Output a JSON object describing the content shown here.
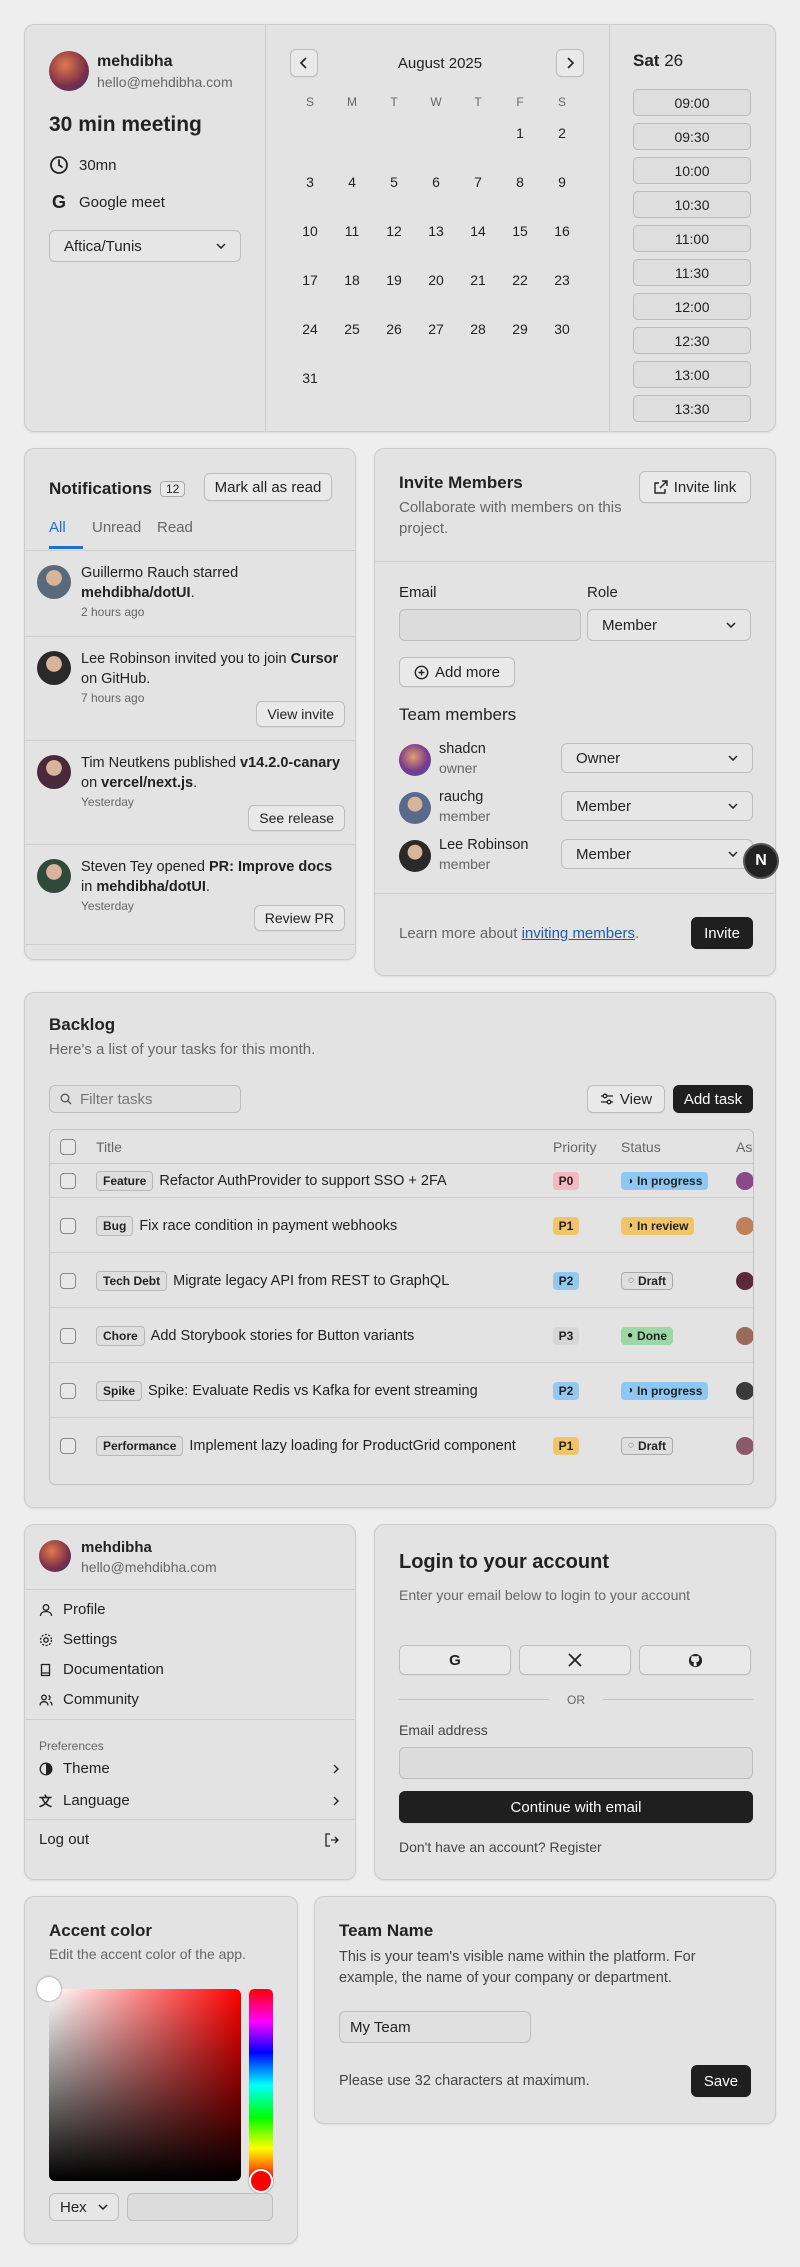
{
  "scheduler": {
    "user": {
      "name": "mehdibha",
      "email": "hello@mehdibha.com"
    },
    "meeting_title": "30 min meeting",
    "duration": "30mn",
    "location": "Google meet",
    "timezone": "Aftica/Tunis",
    "month_label": "August 2025",
    "weekdays": [
      "S",
      "M",
      "T",
      "W",
      "T",
      "F",
      "S"
    ],
    "weeks": [
      [
        "",
        "",
        "",
        "",
        "",
        "1",
        "2"
      ],
      [
        "3",
        "4",
        "5",
        "6",
        "7",
        "8",
        "9"
      ],
      [
        "10",
        "11",
        "12",
        "13",
        "14",
        "15",
        "16"
      ],
      [
        "17",
        "18",
        "19",
        "20",
        "21",
        "22",
        "23"
      ],
      [
        "24",
        "25",
        "26",
        "27",
        "28",
        "29",
        "30"
      ],
      [
        "31",
        "",
        "",
        "",
        "",
        "",
        ""
      ]
    ],
    "selected_day_name": "Sat",
    "selected_day_num": "26",
    "slots": [
      "09:00",
      "09:30",
      "10:00",
      "10:30",
      "11:00",
      "11:30",
      "12:00",
      "12:30",
      "13:00",
      "13:30"
    ]
  },
  "notifications": {
    "title": "Notifications",
    "count": "12",
    "mark_all": "Mark all as read",
    "tabs": [
      "All",
      "Unread",
      "Read"
    ],
    "items": [
      {
        "name": "Guillermo Rauch",
        "action": " starred ",
        "target": "mehdibha/dotUI",
        "after": ".",
        "time": "2 hours ago",
        "button": "",
        "avatar_color": "#5a6a7a"
      },
      {
        "name": "Lee Robinson",
        "action": " invited you to join ",
        "target": "Cursor",
        "after": " on GitHub.",
        "time": "7 hours ago",
        "button": "View invite",
        "avatar_color": "#2a2a2a"
      },
      {
        "name": "Tim Neutkens",
        "action": " published ",
        "target": "v14.2.0-canary",
        "after": " on ",
        "target2": "vercel/next.js",
        "after2": ".",
        "time": "Yesterday",
        "button": "See release",
        "avatar_color": "#4a2a3a"
      },
      {
        "name": "Steven Tey",
        "action": " opened ",
        "target": "PR: Improve docs",
        "after": " in ",
        "target2": "mehdibha/dotUI",
        "after2": ".",
        "time": "Yesterday",
        "button": "Review PR",
        "avatar_color": "#2f4a3a"
      }
    ]
  },
  "invite": {
    "title": "Invite Members",
    "subtitle": "Collaborate with members on this project.",
    "invite_link": "Invite link",
    "email_label": "Email",
    "role_label": "Role",
    "role_value": "Member",
    "add_more": "Add more",
    "team_title": "Team members",
    "members": [
      {
        "name": "shadcn",
        "role": "owner",
        "select": "Owner"
      },
      {
        "name": "rauchg",
        "role": "member",
        "select": "Member"
      },
      {
        "name": "Lee Robinson",
        "role": "member",
        "select": "Member"
      }
    ],
    "learn_prefix": "Learn more about ",
    "learn_link": "inviting members",
    "learn_suffix": ".",
    "invite_button": "Invite",
    "fab_letter": "N"
  },
  "backlog": {
    "title": "Backlog",
    "subtitle": "Here's a list of your tasks for this month.",
    "filter_placeholder": "Filter tasks",
    "view": "View",
    "add_task": "Add task",
    "columns": {
      "title": "Title",
      "priority": "Priority",
      "status": "Status",
      "assignee": "As"
    },
    "rows": [
      {
        "tag": "Feature",
        "title": "Refactor AuthProvider to support SSO + 2FA",
        "priority": "P0",
        "status": "In progress"
      },
      {
        "tag": "Bug",
        "title": "Fix race condition in payment webhooks",
        "priority": "P1",
        "status": "In review"
      },
      {
        "tag": "Tech Debt",
        "title": "Migrate legacy API from REST to GraphQL",
        "priority": "P2",
        "status": "Draft"
      },
      {
        "tag": "Chore",
        "title": "Add Storybook stories for Button variants",
        "priority": "P3",
        "status": "Done"
      },
      {
        "tag": "Spike",
        "title": "Spike: Evaluate Redis vs Kafka for event streaming",
        "priority": "P2",
        "status": "In progress"
      },
      {
        "tag": "Performance",
        "title": "Implement lazy loading for ProductGrid component",
        "priority": "P1",
        "status": "Draft"
      }
    ],
    "colors": {
      "P0": "#f5b8c0",
      "P1": "#f0c46a",
      "P2": "#93c8f0",
      "P3": "#d6d6d6",
      "In progress": "#8ec8f2",
      "In review": "#f0c46a",
      "Draft": "#dedede",
      "Done": "#9ed7a6"
    }
  },
  "usermenu": {
    "name": "mehdibha",
    "email": "hello@mehdibha.com",
    "items": [
      "Profile",
      "Settings",
      "Documentation",
      "Community"
    ],
    "prefs_label": "Preferences",
    "theme": "Theme",
    "language": "Language",
    "logout": "Log out"
  },
  "login": {
    "title": "Login to your account",
    "subtitle": "Enter your email below to login to your account",
    "or": "OR",
    "email_label": "Email address",
    "continue": "Continue with email",
    "no_account": "Don't have an account? Register"
  },
  "accent": {
    "title": "Accent color",
    "subtitle": "Edit the accent color of the app.",
    "format": "Hex",
    "hue_color": "#ff0000"
  },
  "team": {
    "title": "Team Name",
    "desc": "This is your team's visible name within the platform. For example, the name of your company or department.",
    "value": "My Team",
    "hint": "Please use 32 characters at maximum.",
    "save": "Save"
  }
}
